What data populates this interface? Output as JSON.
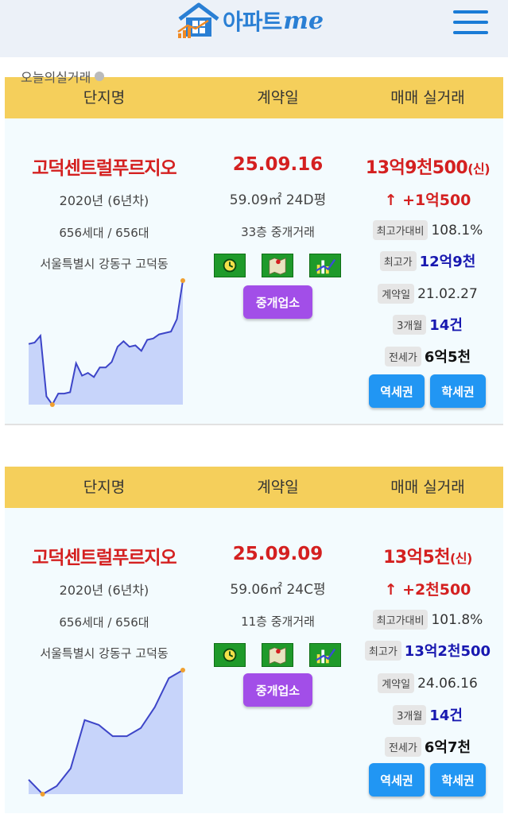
{
  "app": {
    "logo_text": "아파트",
    "logo_me": "me"
  },
  "section_title": "오늘의실거래",
  "colors": {
    "header_bg": "#f5cf5b",
    "red": "#d42020",
    "blue": "#1818b0",
    "broker_purple": "#a24ee8",
    "button_blue": "#2196f3",
    "icon_green": "#1f9a2a"
  },
  "icons": [
    "house-logo-icon",
    "menu-icon",
    "clock-icon",
    "map-icon",
    "chart-icon"
  ],
  "columns": [
    "단지명",
    "계약일",
    "매매 실거래"
  ],
  "labels": {
    "max_ratio": "최고가대비",
    "max_price": "최고가",
    "contract": "계약일",
    "jeonse": "전세가",
    "broker": "중개업소",
    "station": "역세권",
    "school": "학세권"
  },
  "listings": [
    {
      "name": "고덕센트럴푸르지오",
      "year": "2020년 (6년차)",
      "households": "656세대 / 656대",
      "address": "서울특별시 강동구 고덕동",
      "date": "25.09.16",
      "area": "59.09㎡ 24D평",
      "floor": "33층 중개거래",
      "price": "13억9천500",
      "price_tag": "(신)",
      "change": "↑ +1억500",
      "max_ratio": "108.1%",
      "max_price": "12억9천",
      "max_date": "21.02.27",
      "period_label": "3개월",
      "period_value": "14건",
      "jeonse": "6억5천",
      "chart_data": {
        "type": "area",
        "values": [
          44,
          45,
          50,
          6,
          0,
          8,
          8,
          9,
          30,
          21,
          23,
          20,
          27,
          27,
          31,
          42,
          46,
          42,
          43,
          39,
          47,
          48,
          51,
          52,
          53,
          62,
          90
        ]
      }
    },
    {
      "name": "고덕센트럴푸르지오",
      "year": "2020년 (6년차)",
      "households": "656세대 / 656대",
      "address": "서울특별시 강동구 고덕동",
      "date": "25.09.09",
      "area": "59.06㎡ 24C평",
      "floor": "11층 중개거래",
      "price": "13억5천",
      "price_tag": "(신)",
      "change": "↑ +2천500",
      "max_ratio": "101.8%",
      "max_price": "13억2천500",
      "max_date": "24.06.16",
      "period_label": "3개월",
      "period_value": "14건",
      "jeonse": "6억7천",
      "chart_data": {
        "type": "area",
        "values": [
          12,
          3,
          8,
          19,
          49,
          46,
          39,
          39,
          44,
          57,
          75,
          80
        ]
      }
    }
  ]
}
